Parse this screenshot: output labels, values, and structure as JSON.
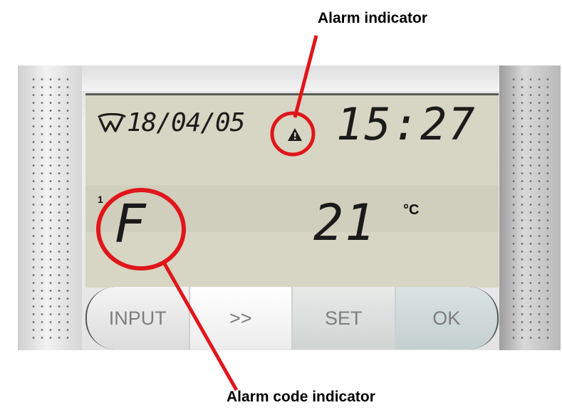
{
  "callouts": {
    "alarm_indicator": "Alarm indicator",
    "alarm_code_indicator": "Alarm code indicator"
  },
  "lcd": {
    "date": "18/04/05",
    "time": "15:27",
    "alarm_code": "F",
    "channel_index": "1",
    "temperature": "21",
    "unit": "°C"
  },
  "buttons": [
    "INPUT",
    ">>",
    "SET",
    "OK"
  ],
  "colors": {
    "annotation": "#e0161b",
    "lcd_background": "#d7d5c3",
    "lcd_segments": "#1b1b1b",
    "button_text": "#7d7d7d"
  },
  "icons": [
    "brand-logo-icon",
    "alarm-warning-icon"
  ]
}
